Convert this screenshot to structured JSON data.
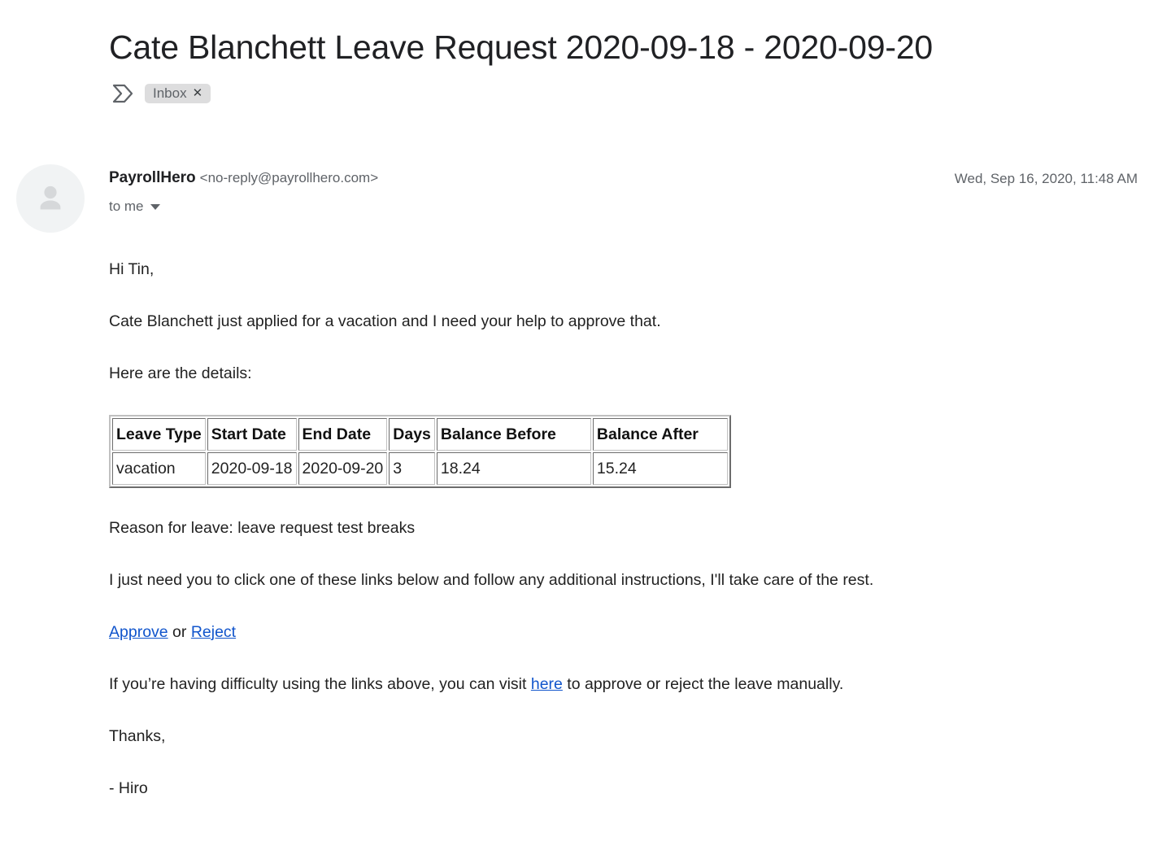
{
  "email": {
    "subject": "Cate Blanchett Leave Request 2020-09-18 - 2020-09-20",
    "labels": {
      "arrow_icon": "label-arrow-icon",
      "inbox_label": "Inbox",
      "inbox_remove": "✕"
    },
    "sender": {
      "avatar_icon": "person-avatar-icon",
      "name": "PayrollHero",
      "address": "<no-reply@payrollhero.com>",
      "recipient": "to me",
      "details_caret": "chevron-down-icon"
    },
    "timestamp": "Wed, Sep 16, 2020, 11:48 AM",
    "body": {
      "greeting": "Hi Tin,",
      "intro": "Cate Blanchett just applied for a vacation and I need your help to approve that.",
      "details_lead": "Here are the details:",
      "reason": "Reason for leave: leave request test breaks",
      "instructions": "I just need you to click one of these links below and follow any additional instructions, I'll take care of the rest.",
      "action_prefix": "",
      "approve_link": "Approve",
      "action_separator": " or ",
      "reject_link": "Reject",
      "fallback_before": "If you’re having difficulty using the links above, you can visit ",
      "fallback_link": "here",
      "fallback_after": " to approve or reject the leave manually.",
      "closing": "Thanks,",
      "signature": "- Hiro"
    },
    "table": {
      "headers": [
        "Leave Type",
        "Start Date",
        "End Date",
        "Days",
        "Balance Before",
        "Balance After"
      ],
      "rows": [
        {
          "leave_type": "vacation",
          "start_date": "2020-09-18",
          "end_date": "2020-09-20",
          "days": "3",
          "balance_before": "18.24",
          "balance_after": "15.24"
        }
      ]
    },
    "colors": {
      "link": "#1155cc",
      "subject": "#202124",
      "meta": "#5f6368",
      "body": "#222222",
      "chip_bg": "#ddddde"
    }
  }
}
